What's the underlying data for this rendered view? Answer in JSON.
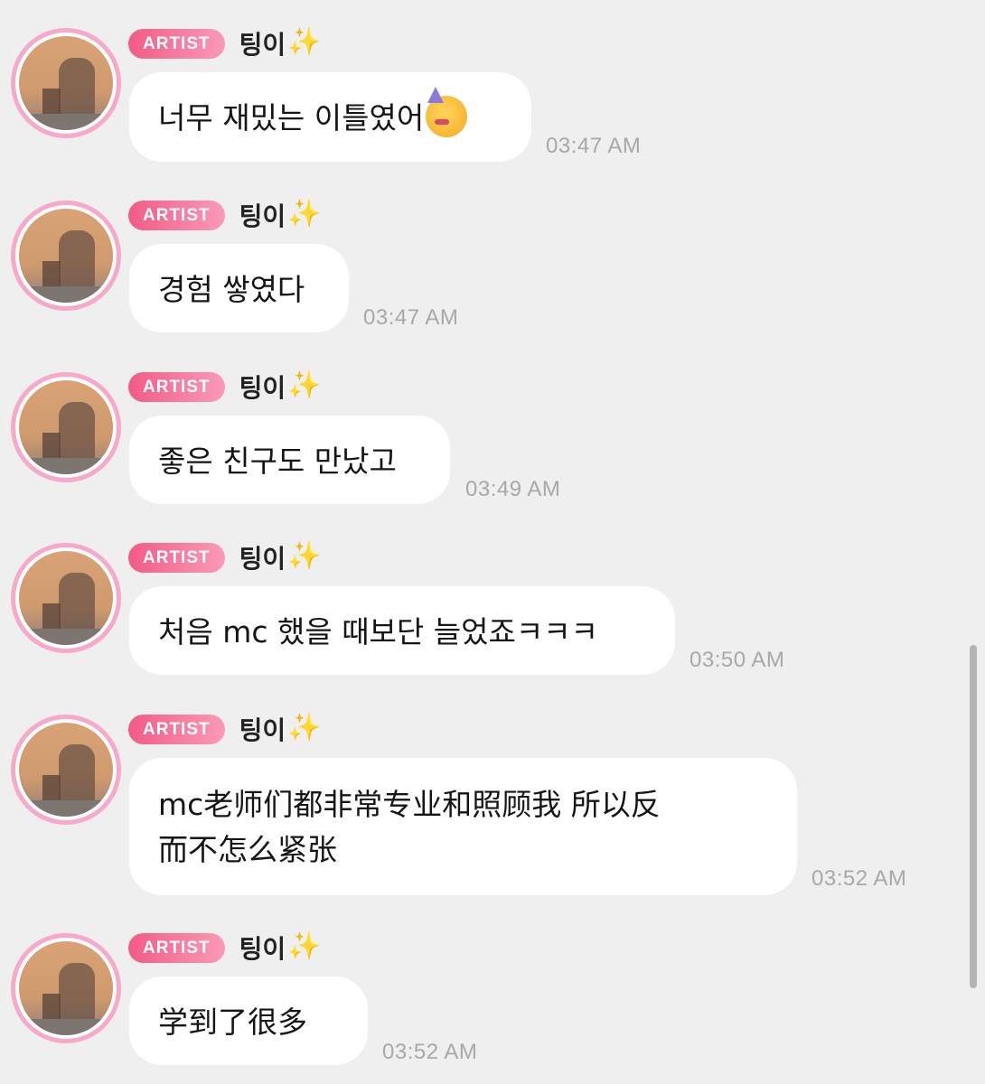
{
  "badge_label": "ARTIST",
  "sender_name": "팅이",
  "sparkle_icon": "✨",
  "messages": [
    {
      "text": "너무 재밌는 이틀였어",
      "emoji": "partying-face",
      "time": "03:47 AM"
    },
    {
      "text": "경험 쌓였다",
      "time": "03:47 AM"
    },
    {
      "text": "좋은 친구도 만났고",
      "time": "03:49 AM"
    },
    {
      "text": "처음 mc 했을 때보단 늘었죠ㅋㅋㅋ",
      "time": "03:50 AM"
    },
    {
      "text_line1": "mc老师们都非常专业和照顾我 所以反",
      "text_line2": "而不怎么紧张",
      "time": "03:52 AM"
    },
    {
      "text": "学到了很多",
      "time": "03:52 AM"
    }
  ],
  "colors": {
    "background": "#efeff0",
    "badge_start": "#f25b86",
    "badge_end": "#fa9ab8",
    "avatar_ring": "#f7a9c9",
    "time_text": "#a8a8ab"
  }
}
